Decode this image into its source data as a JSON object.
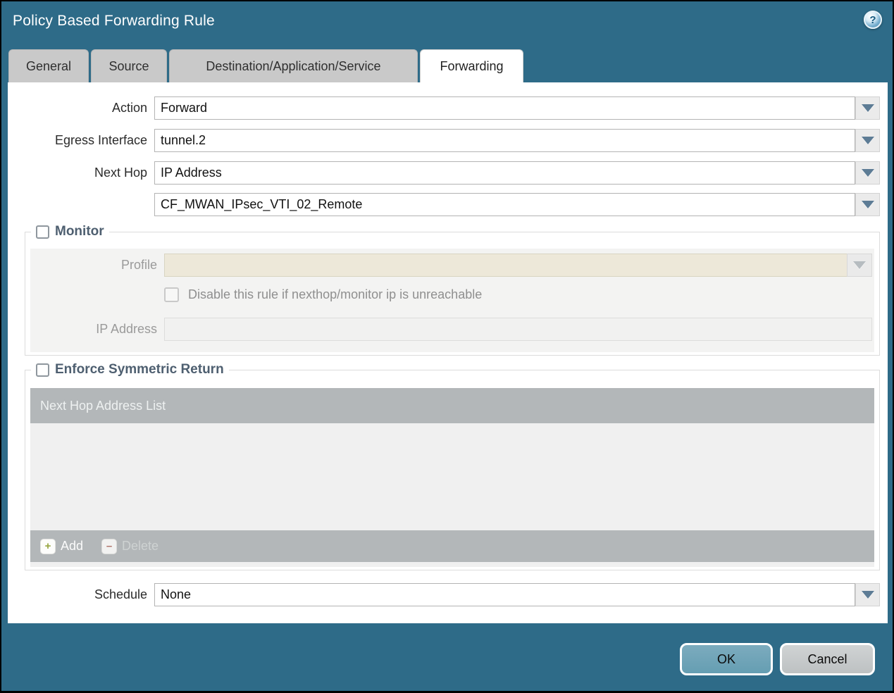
{
  "window": {
    "title": "Policy Based Forwarding Rule",
    "help_glyph": "?"
  },
  "tabs": [
    {
      "label": "General",
      "active": false
    },
    {
      "label": "Source",
      "active": false
    },
    {
      "label": "Destination/Application/Service",
      "active": false
    },
    {
      "label": "Forwarding",
      "active": true
    }
  ],
  "form": {
    "action": {
      "label": "Action",
      "value": "Forward"
    },
    "egress_interface": {
      "label": "Egress Interface",
      "value": "tunnel.2"
    },
    "next_hop": {
      "label": "Next Hop",
      "value": "IP Address"
    },
    "next_hop_address": {
      "value": "CF_MWAN_IPsec_VTI_02_Remote"
    },
    "schedule": {
      "label": "Schedule",
      "value": "None"
    }
  },
  "monitor": {
    "legend": "Monitor",
    "checked": false,
    "profile": {
      "label": "Profile",
      "value": ""
    },
    "disable_rule_checkbox": {
      "label": "Disable this rule if nexthop/monitor ip is unreachable",
      "checked": false
    },
    "ip_address": {
      "label": "IP Address",
      "value": ""
    }
  },
  "enforce_symmetric_return": {
    "legend": "Enforce Symmetric Return",
    "checked": false,
    "table": {
      "header": "Next Hop Address List",
      "rows": []
    },
    "add_label": "Add",
    "delete_label": "Delete",
    "add_glyph": "+",
    "delete_glyph": "–"
  },
  "footer": {
    "ok_label": "OK",
    "cancel_label": "Cancel"
  },
  "colors": {
    "dialog_teal": "#2e6b88",
    "tab_inactive": "#c9c9c9",
    "table_gray": "#b3b7b9",
    "disabled_beige": "#ede8d9",
    "panel_gray": "#f3f3f2",
    "legend_text": "#4e5f70",
    "arrow_blue_gray": "#5d7c95",
    "ok_button": "#6fa3b7",
    "cancel_button": "#c6c9ca",
    "add_icon_green": "#96a53f",
    "delete_icon_red": "#b06a5e"
  }
}
